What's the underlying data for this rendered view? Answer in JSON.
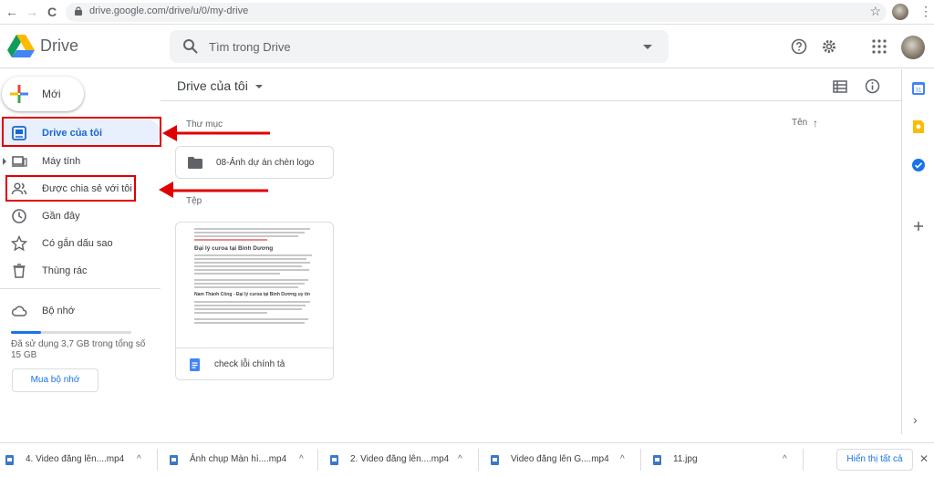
{
  "browser": {
    "back": "←",
    "forward": "→",
    "reload": "C",
    "url": "drive.google.com/drive/u/0/my-drive",
    "bookmark_icon": "☆",
    "menu_icon": "⋮"
  },
  "header": {
    "brand": "Drive",
    "search_placeholder": "Tìm trong Drive"
  },
  "sidebar": {
    "new_label": "Mới",
    "items": [
      {
        "label": "Drive của tôi",
        "icon": "my-drive-icon"
      },
      {
        "label": "Máy tính",
        "icon": "computer-icon"
      },
      {
        "label": "Được chia sẻ với tôi",
        "icon": "shared-icon"
      },
      {
        "label": "Gần đây",
        "icon": "clock-icon"
      },
      {
        "label": "Có gắn dấu sao",
        "icon": "star-icon"
      },
      {
        "label": "Thùng rác",
        "icon": "trash-icon"
      }
    ],
    "storage_label": "Bộ nhớ",
    "storage_used_fraction": 0.25,
    "storage_text": "Đã sử dụng 3,7 GB trong tổng số 15 GB",
    "buy_label": "Mua bộ nhớ"
  },
  "main": {
    "title": "Drive của tôi",
    "folders_heading": "Thư mục",
    "sort_label": "Tên",
    "sort_arrow": "↑",
    "folder_name": "08-Ảnh dự án chèn logo",
    "files_heading": "Tệp",
    "file_name": "check lỗi chính tả",
    "preview": {
      "heading1": "Đại lý curoa tại Bình Dương",
      "heading2": "Nam Thành Công - Đại lý curoa tại Bình Dương uy tín"
    }
  },
  "downloads": [
    {
      "label": "4. Video đăng lên....mp4",
      "chevron": "^"
    },
    {
      "label": "Ảnh chụp Màn hì....mp4",
      "chevron": "^"
    },
    {
      "label": "2. Video đăng lên....mp4",
      "chevron": "^"
    },
    {
      "label": "Video đăng lên G....mp4",
      "chevron": "^"
    },
    {
      "label": "11.jpg",
      "chevron": "^"
    }
  ],
  "show_all": "Hiển thị tất cả",
  "close_downloads": "✕",
  "right_panel_expand": "›",
  "colors": {
    "accent": "#1a73e8",
    "active_bg": "#e8f0fe",
    "annotation_red": "#e00000"
  }
}
